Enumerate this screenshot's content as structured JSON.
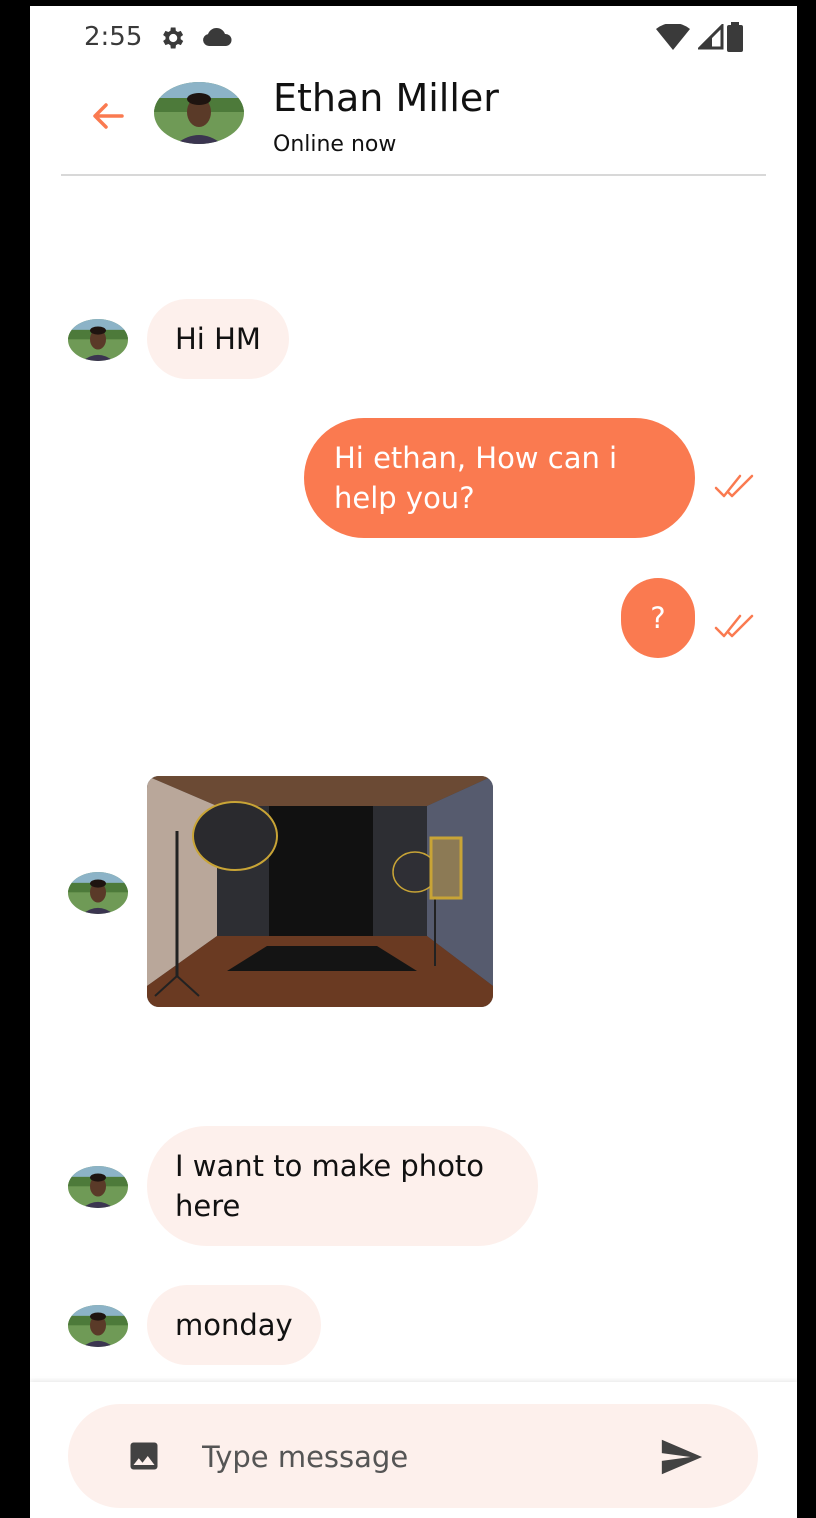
{
  "status_bar": {
    "time": "2:55",
    "icons": [
      "gear-icon",
      "cloud-icon",
      "wifi-icon",
      "signal-icon",
      "battery-icon"
    ]
  },
  "header": {
    "contact_name": "Ethan Miller",
    "contact_status": "Online now",
    "back_icon": "arrow-left-icon"
  },
  "messages": [
    {
      "direction": "incoming",
      "type": "text",
      "text": "Hi HM"
    },
    {
      "direction": "outgoing",
      "type": "text",
      "text": "Hi ethan, How can i help you?",
      "read": true
    },
    {
      "direction": "outgoing",
      "type": "text",
      "text": "?",
      "read": true
    },
    {
      "direction": "incoming",
      "type": "image",
      "description": "photo studio"
    },
    {
      "direction": "incoming",
      "type": "text",
      "text": "I want to make photo here"
    },
    {
      "direction": "incoming",
      "type": "text",
      "text": "monday"
    }
  ],
  "composer": {
    "placeholder": "Type message",
    "image_icon": "image-icon",
    "send_icon": "send-icon"
  },
  "colors": {
    "accent": "#fa7a50",
    "incoming_bubble": "#fdf0ec",
    "composer_bg": "#fdf0ec"
  }
}
